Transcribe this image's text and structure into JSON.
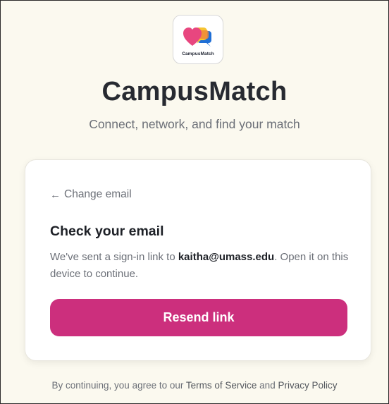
{
  "brand": {
    "logo_text": "CampusMatch",
    "title": "CampusMatch",
    "tagline": "Connect, network, and find your match",
    "accent_color": "#cc2f7d",
    "logo_icon": "heart-chat-bubbles-icon"
  },
  "card": {
    "back_arrow_icon": "arrow-left-icon",
    "back_arrow": "←",
    "back_label": "Change email",
    "title": "Check your email",
    "message_prefix": "We've sent a sign-in link to ",
    "email": "kaitha@umass.edu",
    "message_suffix": ". Open it on this device to continue.",
    "button_label": "Resend link"
  },
  "footer": {
    "prefix": "By continuing, you agree to our ",
    "terms_label": "Terms of Service",
    "joiner": " and ",
    "privacy_label": "Privacy Policy"
  }
}
